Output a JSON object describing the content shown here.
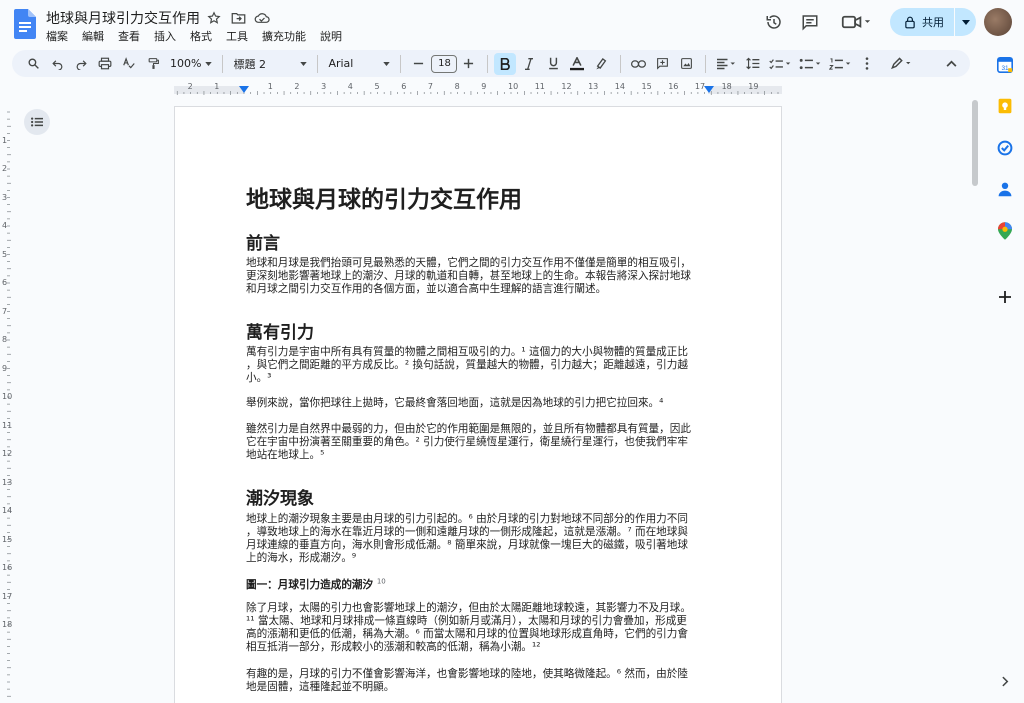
{
  "app": {
    "doc_title": "地球與月球引力交互作用",
    "menu": [
      "檔案",
      "編輯",
      "查看",
      "插入",
      "格式",
      "工具",
      "擴充功能",
      "說明"
    ],
    "share_label": "共用"
  },
  "toolbar": {
    "zoom": "100%",
    "style": "標題 2",
    "font": "Arial",
    "font_size": "18"
  },
  "ruler": {
    "h_numbers": [
      "2",
      "1",
      "1",
      "2",
      "3",
      "4",
      "5",
      "6",
      "7",
      "8",
      "9",
      "10",
      "11",
      "12",
      "13",
      "14",
      "15",
      "16",
      "17",
      "18",
      "19"
    ],
    "v_numbers": [
      "1",
      "2",
      "3",
      "4",
      "5",
      "6",
      "7",
      "8",
      "9",
      "10",
      "11",
      "12",
      "13",
      "14",
      "15",
      "16",
      "17",
      "18"
    ]
  },
  "document": {
    "h1": "地球與月球的引力交互作用",
    "intro_heading": "前言",
    "intro_p": "地球和月球是我們抬頭可見最熟悉的天體，它們之間的引力交互作用不僅僅是簡單的相互吸引，\n更深刻地影響著地球上的潮汐、月球的軌道和自轉，甚至地球上的生命。本報告將深入探討地球\n和月球之間引力交互作用的各個方面，並以適合高中生理解的語言進行闡述。",
    "gravity_heading": "萬有引力",
    "gravity_p1": "萬有引力是宇宙中所有具有質量的物體之間相互吸引的力。¹ 這個力的大小與物體的質量成正比\n，與它們之間距離的平方成反比。² 換句話說，質量越大的物體，引力越大；距離越遠，引力越\n小。³",
    "gravity_p2": "舉例來說，當你把球往上拋時，它最終會落回地面，這就是因為地球的引力把它拉回來。⁴",
    "gravity_p3": "雖然引力是自然界中最弱的力，但由於它的作用範圍是無限的，並且所有物體都具有質量，因此\n它在宇宙中扮演著至關重要的角色。² 引力使行星繞恆星運行，衛星繞行星運行，也使我們牢牢\n地站在地球上。⁵",
    "tides_heading": "潮汐現象",
    "tides_p1": "地球上的潮汐現象主要是由月球的引力引起的。⁶ 由於月球的引力對地球不同部分的作用力不同\n，導致地球上的海水在靠近月球的一側和遠離月球的一側形成隆起，這就是漲潮。⁷ 而在地球與\n月球連線的垂直方向，海水則會形成低潮。⁸ 簡單來說，月球就像一塊巨大的磁鐵，吸引著地球\n上的海水，形成潮汐。⁹",
    "figure_caption": "圖一：月球引力造成的潮汐",
    "figure_ref": "10",
    "tides_p2": "除了月球，太陽的引力也會影響地球上的潮汐，但由於太陽距離地球較遠，其影響力不及月球。\n¹¹ 當太陽、地球和月球排成一條直線時（例如新月或滿月），太陽和月球的引力會疊加，形成更\n高的漲潮和更低的低潮，稱為大潮。⁶ 而當太陽和月球的位置與地球形成直角時，它們的引力會\n相互抵消一部分，形成較小的漲潮和較高的低潮，稱為小潮。¹²",
    "tides_p3": "有趣的是，月球的引力不僅會影響海洋，也會影響地球的陸地，使其略微隆起。⁶ 然而，由於陸\n地是固體，這種隆起並不明顯。"
  },
  "colors": {
    "accent": "#0b57d0",
    "share_bg": "#c2e7ff",
    "toolbar_bg": "#edf2fa",
    "page_bg": "#ffffff",
    "canvas_bg": "#f9fbfd"
  },
  "side_icons": [
    "calendar-icon",
    "keep-icon",
    "tasks-icon",
    "contacts-icon",
    "maps-icon",
    "add-icon"
  ]
}
